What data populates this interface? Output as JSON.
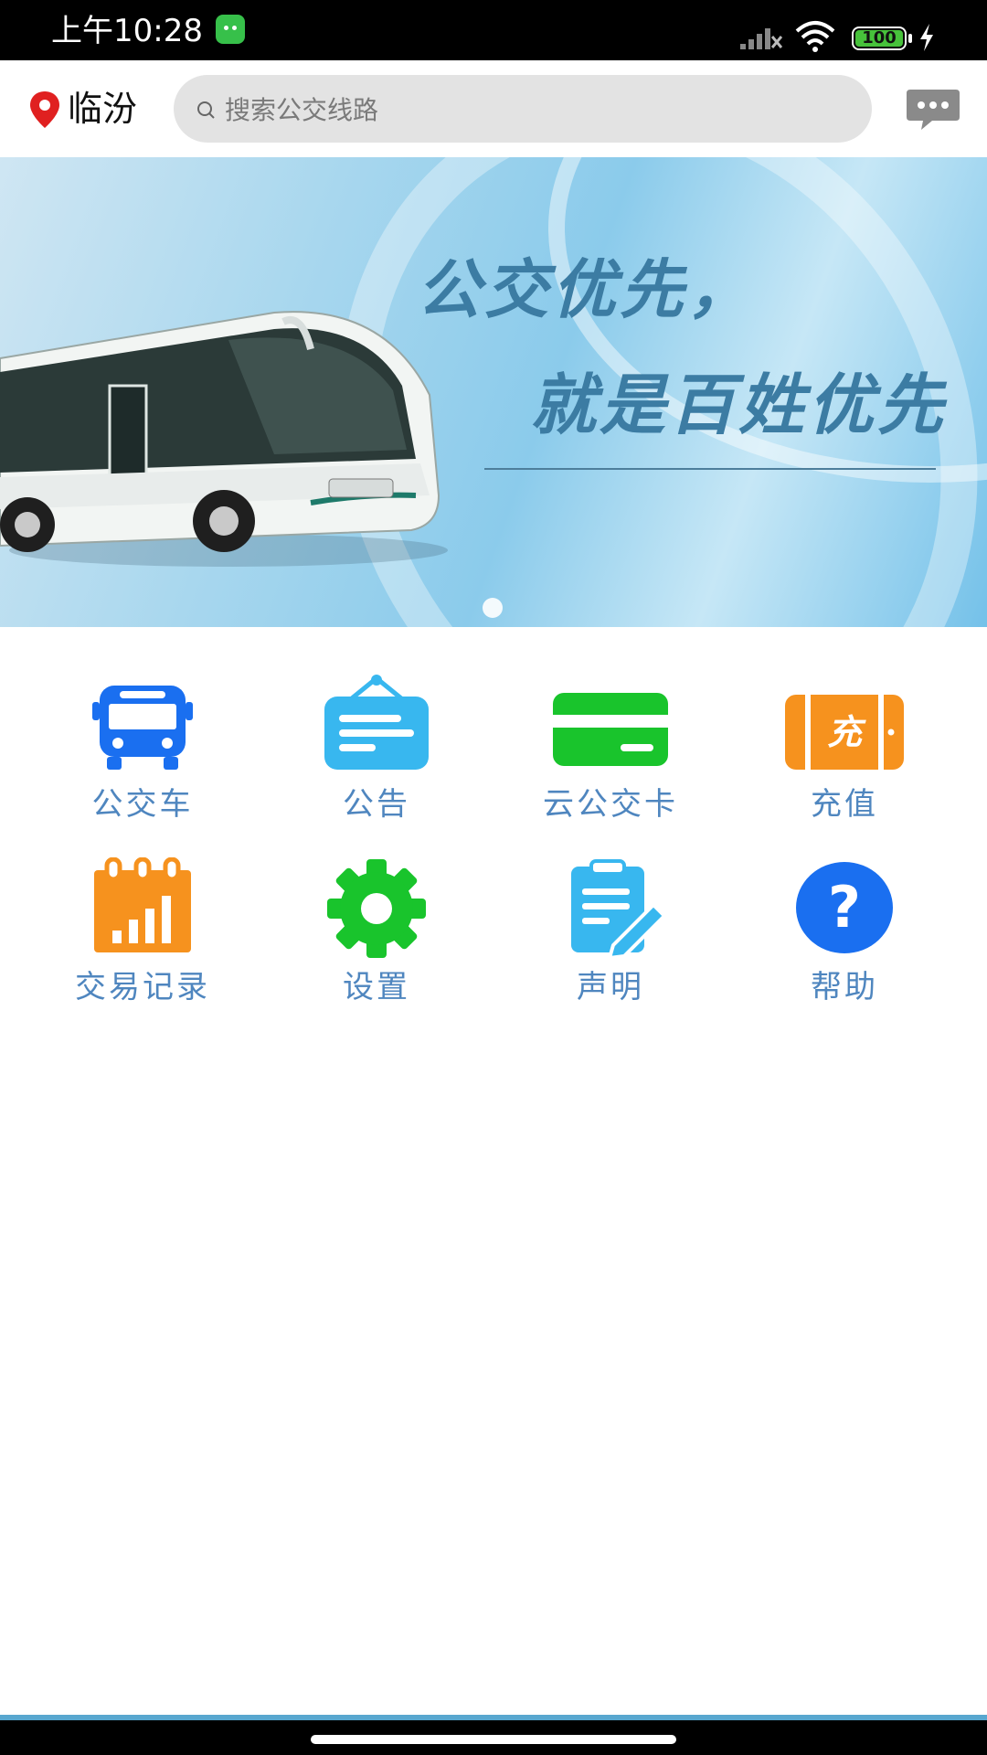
{
  "status_bar": {
    "time": "上午10:28",
    "battery": "100",
    "icons": [
      "app-notification-icon",
      "signal-icon",
      "wifi-icon",
      "battery-icon",
      "charging-bolt-icon"
    ]
  },
  "header": {
    "city": "临汾",
    "search_placeholder": "搜索公交线路",
    "icons": [
      "location-pin-icon",
      "search-icon",
      "message-icon"
    ]
  },
  "banner": {
    "line1": "公交优先，",
    "line2": "就是百姓优先"
  },
  "menu": [
    {
      "label": "公交车",
      "icon": "bus-icon",
      "color": "#1a6ff0"
    },
    {
      "label": "公告",
      "icon": "notice-board-icon",
      "color": "#38b7ef"
    },
    {
      "label": "云公交卡",
      "icon": "card-icon",
      "color": "#19c42c"
    },
    {
      "label": "充值",
      "icon": "recharge-icon",
      "color": "#f6921e",
      "glyph": "充"
    },
    {
      "label": "交易记录",
      "icon": "transaction-chart-icon",
      "color": "#f6921e"
    },
    {
      "label": "设置",
      "icon": "gear-icon",
      "color": "#19c42c"
    },
    {
      "label": "声明",
      "icon": "statement-icon",
      "color": "#38b7ef"
    },
    {
      "label": "帮助",
      "icon": "help-icon",
      "color": "#1a6ff0",
      "glyph": "?"
    }
  ]
}
